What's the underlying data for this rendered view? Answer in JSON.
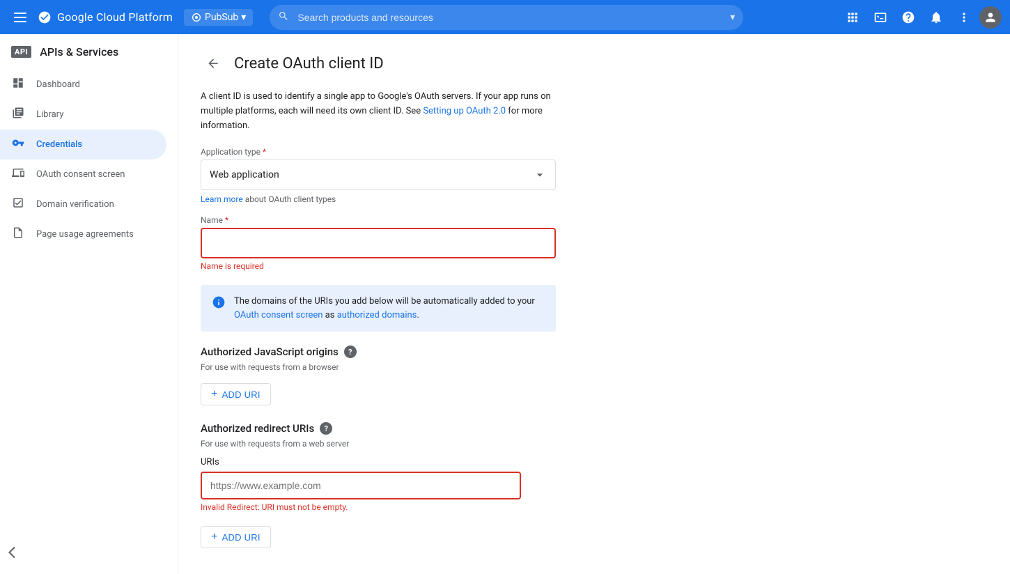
{
  "topbar": {
    "app_name": "Google Cloud Platform",
    "project_name": "PubSub",
    "search_placeholder": "Search products and resources",
    "hamburger_icon": "☰",
    "dropdown_icon": "▾",
    "expand_icon": "▾",
    "search_icon": "🔍"
  },
  "sidebar": {
    "api_badge": "API",
    "title": "APIs & Services",
    "items": [
      {
        "label": "Dashboard",
        "icon": "⊕"
      },
      {
        "label": "Library",
        "icon": "☰"
      },
      {
        "label": "Credentials",
        "icon": "🔑",
        "active": true
      },
      {
        "label": "OAuth consent screen",
        "icon": "⋮⋮"
      },
      {
        "label": "Domain verification",
        "icon": "☑"
      },
      {
        "label": "Page usage agreements",
        "icon": "⋮⋮"
      }
    ],
    "collapse_icon": "◁"
  },
  "page": {
    "back_icon": "←",
    "title": "Create OAuth client ID",
    "description": "A client ID is used to identify a single app to Google's OAuth servers. If your app runs on multiple platforms, each will need its own client ID. See ",
    "description_link_text": "Setting up OAuth 2.0",
    "description_suffix": " for more information.",
    "app_type_label": "Application type",
    "app_type_required": "*",
    "app_type_value": "Web application",
    "learn_more_prefix": "",
    "learn_more_link": "Learn more",
    "learn_more_suffix": " about OAuth client types",
    "name_label": "Name",
    "name_required": "*",
    "name_placeholder": "",
    "name_error": "Name is required",
    "info_text_prefix": "The domains of the URIs you add below will be automatically added to your ",
    "info_link1": "OAuth consent screen",
    "info_text_mid": " as ",
    "info_link2": "authorized domains",
    "info_text_suffix": ".",
    "js_origins_title": "Authorized JavaScript origins",
    "js_origins_subtitle": "For use with requests from a browser",
    "js_add_uri_label": "+ ADD URI",
    "redirect_uris_title": "Authorized redirect URIs",
    "redirect_uris_subtitle": "For use with requests from a web server",
    "uris_label": "URIs",
    "uri_placeholder": "https://www.example.com",
    "uri_error": "Invalid Redirect: URI must not be empty.",
    "redirect_add_uri_label": "+ ADD URI"
  }
}
